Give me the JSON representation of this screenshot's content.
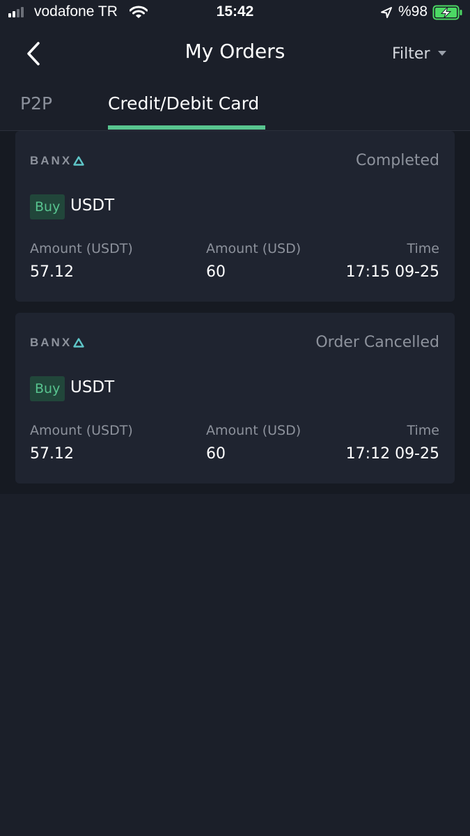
{
  "status_bar": {
    "carrier": "vodafone TR",
    "time": "15:42",
    "battery_percent": "%98",
    "signal_bars_active": 2,
    "signal_bars_total": 4,
    "battery_charging": true,
    "battery_color": "#4cd964",
    "icons": [
      "signal-icon",
      "wifi-icon",
      "location-arrow-icon",
      "battery-charging-icon"
    ]
  },
  "header": {
    "title": "My Orders",
    "filter_label": "Filter",
    "icons": [
      "chevron-left-icon",
      "caret-down-icon"
    ]
  },
  "tabs": [
    {
      "label": "P2P",
      "active": false
    },
    {
      "label": "Credit/Debit Card",
      "active": true
    }
  ],
  "colors": {
    "accent": "#58c48f",
    "background": "#1b1f29",
    "card": "#1f2430",
    "logo_accent": "#5fc6c8"
  },
  "orders": [
    {
      "provider": "BANX",
      "status": "Completed",
      "side": "Buy",
      "asset": "USDT",
      "amount_crypto_label": "Amount (USDT)",
      "amount_crypto": "57.12",
      "amount_fiat_label": "Amount (USD)",
      "amount_fiat": "60",
      "time_label": "Time",
      "time": "17:15 09-25"
    },
    {
      "provider": "BANX",
      "status": "Order Cancelled",
      "side": "Buy",
      "asset": "USDT",
      "amount_crypto_label": "Amount (USDT)",
      "amount_crypto": "57.12",
      "amount_fiat_label": "Amount (USD)",
      "amount_fiat": "60",
      "time_label": "Time",
      "time": "17:12 09-25"
    }
  ]
}
